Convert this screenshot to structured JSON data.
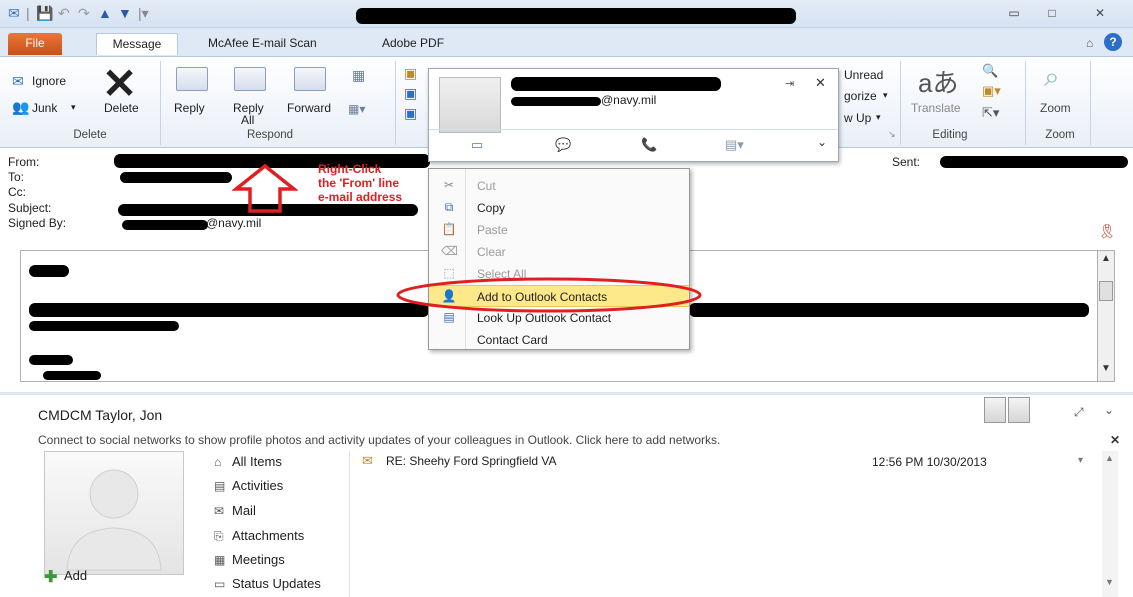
{
  "title_bar": {
    "window_title": ""
  },
  "tabs": [
    "File",
    "Message",
    "McAfee E-mail Scan",
    "Adobe PDF"
  ],
  "ribbon": {
    "delete_group": {
      "label": "Delete",
      "ignore": "Ignore",
      "junk": "Junk",
      "delete": "Delete"
    },
    "respond_group": {
      "label": "Respond",
      "reply": "Reply",
      "reply_all_1": "Reply",
      "reply_all_2": "All",
      "forward": "Forward"
    },
    "tags_group": {
      "mark_unread": "Unread",
      "categorize": "gorize",
      "follow_up": "w Up"
    },
    "editing_group": {
      "label": "Editing",
      "translate": "Translate"
    },
    "zoom_group": {
      "label": "Zoom",
      "zoom": "Zoom"
    }
  },
  "contact_card": {
    "email": "@navy.mil"
  },
  "header": {
    "from_label": "From:",
    "to_label": "To:",
    "cc_label": "Cc:",
    "subject_label": "Subject:",
    "signed_by_label": "Signed By:",
    "signed_by_value": "@navy.mil",
    "sent_label": "Sent:"
  },
  "annotation": {
    "line1": "Right-Click",
    "line2": "the 'From' line",
    "line3": "e-mail address",
    "color": "#e02020"
  },
  "context_menu": {
    "items": [
      {
        "label": "Cut",
        "enabled": false
      },
      {
        "label": "Copy",
        "enabled": true
      },
      {
        "label": "Paste",
        "enabled": false
      },
      {
        "label": "Clear",
        "enabled": false
      },
      {
        "label": "Select All",
        "enabled": false
      },
      {
        "label": "Add to Outlook Contacts",
        "enabled": true,
        "highlighted": true
      },
      {
        "label": "Look Up Outlook Contact",
        "enabled": true
      },
      {
        "label": "Contact Card",
        "enabled": true
      }
    ]
  },
  "people_pane": {
    "name": "CMDCM Taylor, Jon",
    "social_notice": "Connect to social networks to show profile photos and activity updates of your colleagues in Outlook. Click here to add networks.",
    "add_label": "Add",
    "nav": [
      "All Items",
      "Activities",
      "Mail",
      "Attachments",
      "Meetings",
      "Status Updates"
    ],
    "item": {
      "subject": "RE: Sheehy Ford Springfield VA",
      "date": "12:56 PM 10/30/2013"
    }
  },
  "colors": {
    "accent_orange": "#d35f1f",
    "ribbon_blue": "#dfe8f5",
    "highlight": "#fde88a"
  }
}
